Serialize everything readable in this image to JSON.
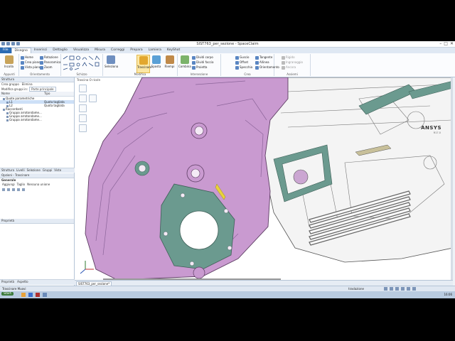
{
  "window": {
    "title": "SIST763_per_sezione - SpaceClaim",
    "controls": [
      "–",
      "□",
      "✕"
    ]
  },
  "tabs": [
    "File",
    "Disegno",
    "Inserisci",
    "Dettaglio",
    "Visualizza",
    "Misura",
    "Correggi",
    "Prepara",
    "Lamiera",
    "KeyShot"
  ],
  "ribbon": {
    "groups": [
      "Appunti",
      "Orientamento",
      "Schizzo",
      "Modifica",
      "Intersezione",
      "Crea",
      "Assiemi"
    ],
    "orient_items": [
      "Home",
      "Crea piano",
      "Vista piano"
    ],
    "pan_items": [
      "Rotazione",
      "Panoramica",
      "Zoom"
    ],
    "big_buttons": [
      "Seleziona",
      "Trascinare",
      "Sposta",
      "Riempi",
      "Combina"
    ],
    "intersect_items": [
      "Dividi corpo",
      "Dividi faccia",
      "Proietta"
    ],
    "create_items": [
      "Guscio",
      "Offset",
      "Specchia"
    ],
    "create_items2": [
      "Tangente",
      "Allinea",
      "Orientamento"
    ],
    "assembly_items": [
      "Rigido",
      "Ingranaggio",
      "Ancora"
    ],
    "paste_label": "Incolla"
  },
  "structure": {
    "header": "Struttura",
    "toolbar": [
      "Crea gruppo",
      "Elimina"
    ],
    "filter_label": "Modifica gruppi in:",
    "filter_value": "Parte principale",
    "columns": [
      "Nome",
      "Tipo"
    ],
    "rows": [
      {
        "name": "Quote parametriche",
        "type": ""
      },
      {
        "name": "L1",
        "type": "Quota tagliata"
      },
      {
        "name": "L2",
        "type": "Quota tagliata"
      },
      {
        "name": "Raccordanti",
        "type": ""
      },
      {
        "name": "Gruppo arrotondame...",
        "type": ""
      },
      {
        "name": "Gruppo arrotondame...",
        "type": ""
      },
      {
        "name": "Gruppo arrotondame...",
        "type": ""
      }
    ],
    "bottom_tabs": [
      "Struttura",
      "Livelli",
      "Selezione",
      "Gruppi",
      "Viste"
    ]
  },
  "options": {
    "header": "Opzioni - Trascinare",
    "section": "Generale",
    "items": [
      "Aggiungi",
      "Taglio",
      "Nessuna unione"
    ]
  },
  "properties": {
    "header": "Proprietà"
  },
  "viewport": {
    "view_label": "Trascina O ricoIn",
    "logo_main": "ANSYS",
    "logo_sub": "R17.0",
    "tab_label": "SIST763_per_sezione*"
  },
  "bottom_panel_tabs": [
    "Proprietà",
    "Aspetto"
  ],
  "status": {
    "left": "Trascinare Muovi",
    "mode": "traslazione"
  },
  "taskbar": {
    "start_label": "Start",
    "clock": "16:06"
  },
  "colors": {
    "part_purple": "#c99ad0",
    "part_grey": "#f2f2f2",
    "gasket": "#6b9a8f",
    "file_tab": "#2a6ab3"
  }
}
